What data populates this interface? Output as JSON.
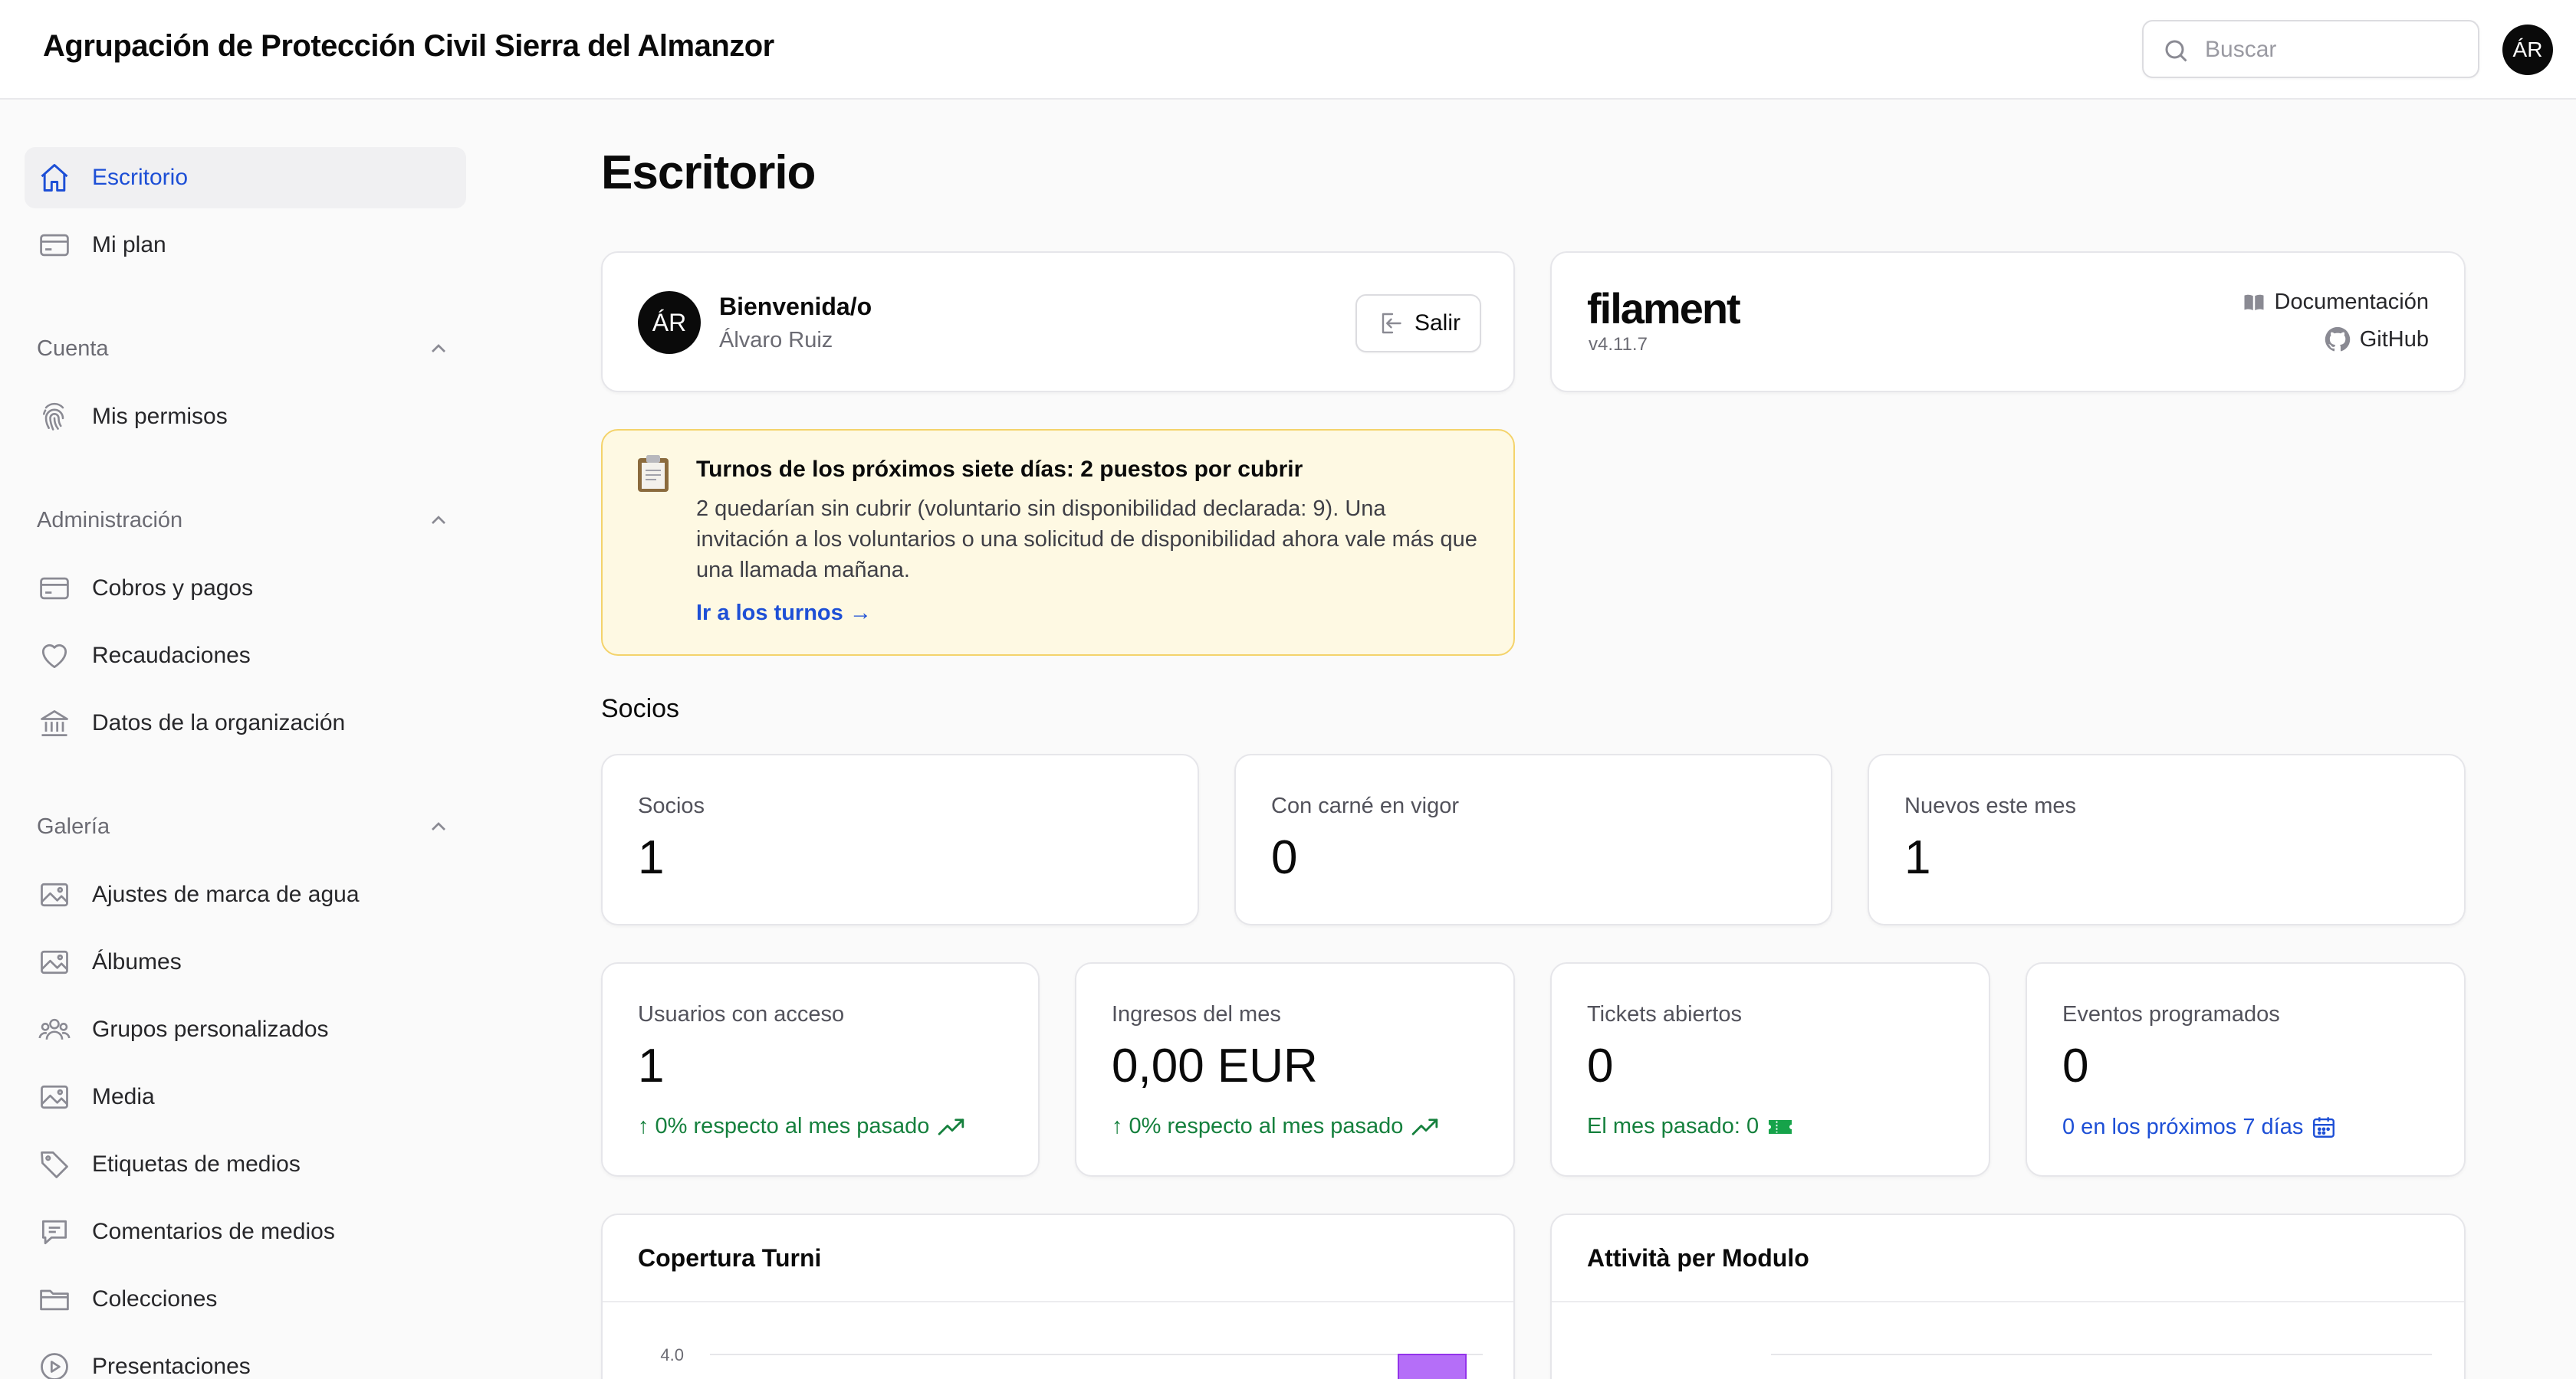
{
  "app": {
    "title": "Agrupación de Protección Civil Sierra del Almanzor",
    "user_initials": "ÁR"
  },
  "search": {
    "placeholder": "Buscar"
  },
  "sidebar": {
    "top_items": [
      {
        "label": "Escritorio",
        "icon": "home-icon",
        "active": true
      },
      {
        "label": "Mi plan",
        "icon": "credit-card-icon",
        "active": false
      }
    ],
    "groups": [
      {
        "label": "Cuenta",
        "items": [
          {
            "label": "Mis permisos",
            "icon": "fingerprint-icon"
          }
        ]
      },
      {
        "label": "Administración",
        "items": [
          {
            "label": "Cobros y pagos",
            "icon": "credit-card-icon"
          },
          {
            "label": "Recaudaciones",
            "icon": "heart-icon"
          },
          {
            "label": "Datos de la organización",
            "icon": "bank-icon"
          }
        ]
      },
      {
        "label": "Galería",
        "items": [
          {
            "label": "Ajustes de marca de agua",
            "icon": "image-icon"
          },
          {
            "label": "Álbumes",
            "icon": "image-icon"
          },
          {
            "label": "Grupos personalizados",
            "icon": "users-icon"
          },
          {
            "label": "Media",
            "icon": "image-icon"
          },
          {
            "label": "Etiquetas de medios",
            "icon": "tag-icon"
          },
          {
            "label": "Comentarios de medios",
            "icon": "chat-icon"
          },
          {
            "label": "Colecciones",
            "icon": "folder-icon"
          },
          {
            "label": "Presentaciones",
            "icon": "play-icon"
          }
        ]
      }
    ]
  },
  "main": {
    "title": "Escritorio",
    "welcome": {
      "title": "Bienvenida/o",
      "name": "Álvaro Ruiz",
      "logout_label": "Salir"
    },
    "filament": {
      "logo": "filament",
      "version": "v4.11.7",
      "docs_label": "Documentación",
      "github_label": "GitHub"
    },
    "alert": {
      "title": "Turnos de los próximos siete días: 2 puestos por cubrir",
      "body": "2 quedarían sin cubrir (voluntario sin disponibilidad declarada: 9). Una invitación a los voluntarios o una solicitud de disponibilidad ahora vale más que una llamada mañana.",
      "link": "Ir a los turnos →"
    },
    "members_section": "Socios",
    "stats_row1": [
      {
        "label": "Socios",
        "value": "1"
      },
      {
        "label": "Con carné en vigor",
        "value": "0"
      },
      {
        "label": "Nuevos este mes",
        "value": "1"
      }
    ],
    "stats_row2": [
      {
        "label": "Usuarios con acceso",
        "value": "1",
        "desc": "↑ 0% respecto al mes pasado",
        "color": "#15803d"
      },
      {
        "label": "Ingresos del mes",
        "value": "0,00 EUR",
        "desc": "↑ 0% respecto al mes pasado",
        "color": "#15803d"
      },
      {
        "label": "Tickets abiertos",
        "value": "0",
        "desc": "El mes pasado: 0",
        "color": "#15803d"
      },
      {
        "label": "Eventos programados",
        "value": "0",
        "desc": "0 en los próximos 7 días",
        "color": "#1d4fd6"
      }
    ],
    "charts": [
      {
        "title": "Copertura Turni",
        "tick_label": "4.0",
        "bar_color": "#a855f7"
      },
      {
        "title": "Attività per Modulo"
      }
    ]
  }
}
